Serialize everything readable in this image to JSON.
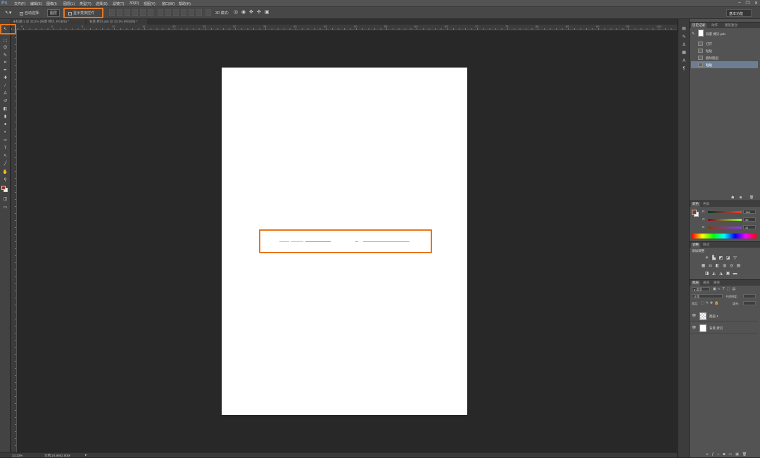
{
  "app": {
    "logo": "Ps"
  },
  "menu": [
    "文件(F)",
    "编辑(E)",
    "图像(I)",
    "图层(L)",
    "类型(Y)",
    "选择(S)",
    "滤镜(T)",
    "3D(D)",
    "视图(V)",
    "窗口(W)",
    "帮助(H)"
  ],
  "window_controls": [
    "–",
    "❐",
    "✕"
  ],
  "options": {
    "auto_select_label": "自动选择:",
    "auto_select_value": "图层",
    "transform_controls_label": "显示变换控件",
    "mode_3d_label": "3D 模式:",
    "workspace": "基本功能"
  },
  "tabs": [
    {
      "label": "未标题-1 @ 33.2% (背景 拷贝, RGB/8) *",
      "active": false
    },
    {
      "label": "背景 拷贝.psb @ 33.3% (RGB/8) *",
      "active": true
    }
  ],
  "ruler_numbers": [
    "5",
    "0",
    "5",
    "10",
    "15",
    "20",
    "25",
    "30",
    "35",
    "40",
    "45",
    "50",
    "55",
    "60",
    "65",
    "70",
    "75",
    "80",
    "85",
    "90",
    "95",
    "100"
  ],
  "tools": [
    "move-tool",
    "marquee-tool",
    "lasso-tool",
    "quick-select-tool",
    "crop-tool",
    "eyedropper-tool",
    "healing-tool",
    "brush-tool",
    "stamp-tool",
    "history-brush-tool",
    "eraser-tool",
    "gradient-tool",
    "blur-tool",
    "dodge-tool",
    "pen-tool",
    "type-tool",
    "path-select-tool",
    "line-tool",
    "hand-tool",
    "zoom-tool"
  ],
  "colors": {
    "foreground": "#8a3a22",
    "background": "#ffffff",
    "highlight": "#e8761c"
  },
  "status": {
    "zoom": "33.33%",
    "doc": "文档:24.9M/2.50M"
  },
  "history_panel": {
    "tabs": [
      "历史记录",
      "动作",
      "图层复合"
    ],
    "snapshot": "背景 拷贝.psb",
    "items": [
      {
        "label": "打开",
        "selected": false
      },
      {
        "label": "粘贴",
        "selected": false
      },
      {
        "label": "删除图层",
        "selected": false
      },
      {
        "label": "粘贴",
        "selected": true
      }
    ]
  },
  "color_panel": {
    "tabs": [
      "颜色",
      "色板"
    ],
    "channels": [
      {
        "name": "R",
        "value": "138"
      },
      {
        "name": "G",
        "value": "58"
      },
      {
        "name": "B",
        "value": "41"
      }
    ]
  },
  "adjustments_panel": {
    "tabs": [
      "调整",
      "样式"
    ],
    "title": "添加调整"
  },
  "layers_panel": {
    "tabs": [
      "图层",
      "通道",
      "路径"
    ],
    "kind": "ρ 类型",
    "blend": "正常",
    "opacity_label": "不透明度:",
    "lock_label": "锁定:",
    "fill_label": "填充:",
    "layers": [
      {
        "name": "图层 1",
        "transparent": true
      },
      {
        "name": "背景 拷贝",
        "transparent": false
      }
    ]
  }
}
